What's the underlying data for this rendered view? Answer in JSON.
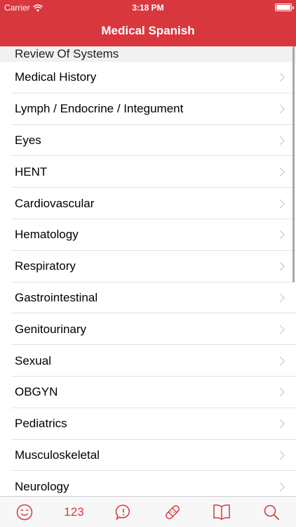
{
  "status_bar": {
    "carrier": "Carrier",
    "time": "3:18 PM"
  },
  "nav": {
    "title": "Medical Spanish"
  },
  "section": {
    "header": "Review Of Systems"
  },
  "rows": [
    {
      "label": "Medical History"
    },
    {
      "label": "Lymph / Endocrine / Integument"
    },
    {
      "label": "Eyes"
    },
    {
      "label": "HENT"
    },
    {
      "label": "Cardiovascular"
    },
    {
      "label": "Hematology"
    },
    {
      "label": "Respiratory"
    },
    {
      "label": "Gastrointestinal"
    },
    {
      "label": "Genitourinary"
    },
    {
      "label": "Sexual"
    },
    {
      "label": "OBGYN"
    },
    {
      "label": "Pediatrics"
    },
    {
      "label": "Musculoskeletal"
    },
    {
      "label": "Neurology"
    }
  ],
  "tabbar": {
    "tabs": [
      {
        "icon": "face-icon"
      },
      {
        "label": "123"
      },
      {
        "icon": "speech-bubble-icon"
      },
      {
        "icon": "bandage-icon"
      },
      {
        "icon": "book-icon"
      },
      {
        "icon": "search-icon"
      }
    ]
  },
  "colors": {
    "accent": "#d9373e",
    "separator": "#e3e3e6",
    "section_bg": "#f1f1f3"
  }
}
